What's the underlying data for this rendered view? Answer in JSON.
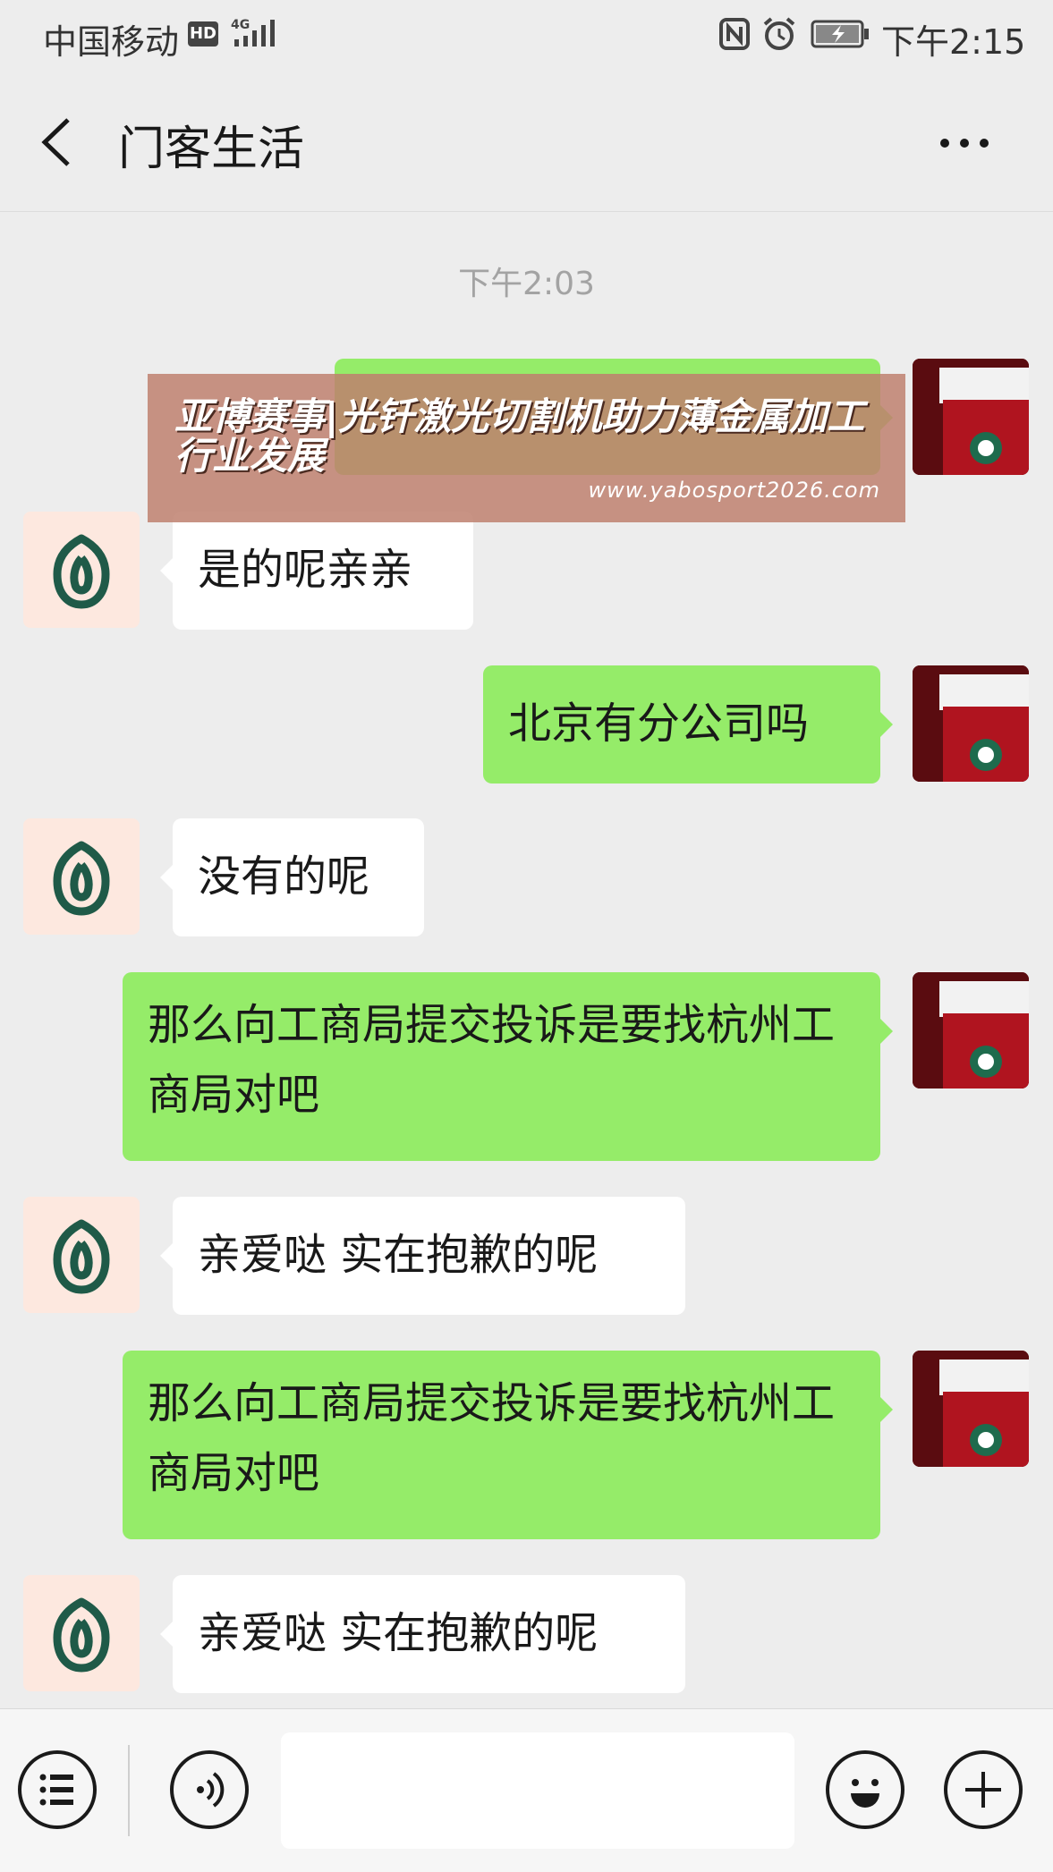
{
  "status_bar": {
    "carrier": "中国移动",
    "hd": "HD",
    "network": "4G",
    "time": "下午2:15",
    "icons": [
      "hd-icon",
      "signal-icon",
      "nfc-icon",
      "alarm-icon",
      "battery-charging-icon"
    ]
  },
  "header": {
    "title": "门客生活",
    "back_icon": "chevron-left-icon",
    "more_icon": "more-dots-icon"
  },
  "timestamp": "下午2:03",
  "overlay": {
    "headline": "亚博赛事|光钎激光切割机助力薄金属加工行业发展",
    "url": "www.yabosport2026.com"
  },
  "messages": [
    {
      "sender": "me",
      "text": ""
    },
    {
      "sender": "other",
      "text": "是的呢亲亲"
    },
    {
      "sender": "me",
      "text": "北京有分公司吗"
    },
    {
      "sender": "other",
      "text": "没有的呢"
    },
    {
      "sender": "me",
      "text": "那么向工商局提交投诉是要找杭州工商局对吧"
    },
    {
      "sender": "other",
      "text": "亲爱哒 实在抱歉的呢"
    },
    {
      "sender": "me",
      "text": "那么向工商局提交投诉是要找杭州工商局对吧"
    },
    {
      "sender": "other",
      "text": "亲爱哒 实在抱歉的呢"
    }
  ],
  "input_bar": {
    "menu_icon": "menu-list-icon",
    "voice_icon": "voice-icon",
    "text_value": "",
    "emoji_icon": "emoji-icon",
    "plus_icon": "plus-icon"
  },
  "colors": {
    "background": "#ededed",
    "my_bubble": "#95ec69",
    "other_bubble": "#ffffff",
    "brand_green": "#1f5a48"
  }
}
